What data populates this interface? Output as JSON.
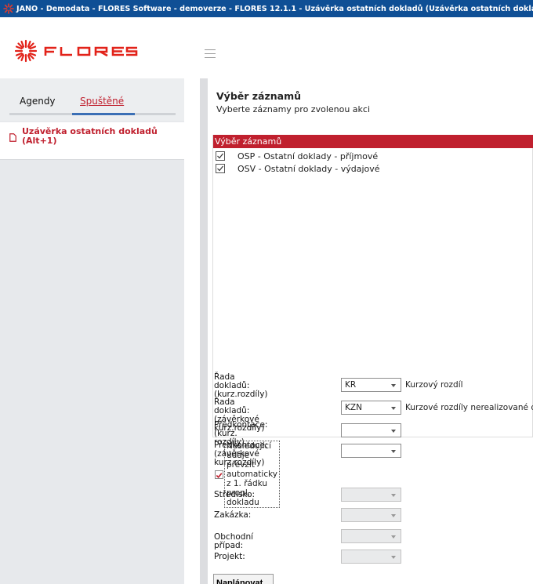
{
  "window": {
    "title": "JANO - Demodata - FLORES Software - demoverze - FLORES 12.1.1 - Uzávěrka ostatních dokladů  (Uzávěrka ostatních doklad"
  },
  "logo": {
    "text": "FLORES",
    "icon": "flores-star-logo"
  },
  "colors": {
    "titlebar": "#0f4f95",
    "accent": "#c0202e",
    "sidebar": "#e7e9ec",
    "tab_active": "#3b6fb5"
  },
  "sidebar": {
    "tabs": [
      {
        "label": "Agendy"
      },
      {
        "label": "Spuštěné",
        "active": true
      }
    ],
    "running": {
      "line1": "Uzávěrka ostatních dokladů",
      "line2": "(Alt+1)"
    }
  },
  "main": {
    "title": "Výběr záznamů",
    "subtitle": "Vyberte záznamy pro zvolenou akci",
    "list_header": "Výběr záznamů",
    "rows": [
      {
        "label": "OSP - Ostatní doklady - příjmové",
        "checked": true
      },
      {
        "label": "OSV - Ostatní doklady - výdajové",
        "checked": true
      }
    ],
    "fields": [
      {
        "label1": "Řada dokladů:",
        "label2": "(kurz.rozdíly)",
        "value": "KR",
        "desc": "Kurzový rozdíl"
      },
      {
        "label1": "Řada dokladů:",
        "label2": "(závěrkové kurz.rozdíly)",
        "value": "KZN",
        "desc": "Kurzové rozdíly nerealizované daň"
      },
      {
        "label1": "Předkontace:",
        "label2": "(kurz. rozdíly)",
        "value": "",
        "desc": ""
      },
      {
        "label1": "Předkontace:",
        "label2": "(závěrkové kurz.rozdíly)",
        "value": "",
        "desc": ""
      }
    ],
    "auto_label": "Následující údaje převzít automaticky z 1. řádku propl. dokladu",
    "auto_checked": true,
    "disabled_fields": [
      {
        "label": "Středisko:"
      },
      {
        "label": "Zakázka:"
      },
      {
        "label": "Obchodní případ:"
      },
      {
        "label": "Projekt:"
      }
    ],
    "plan_button": "Naplánovat"
  }
}
